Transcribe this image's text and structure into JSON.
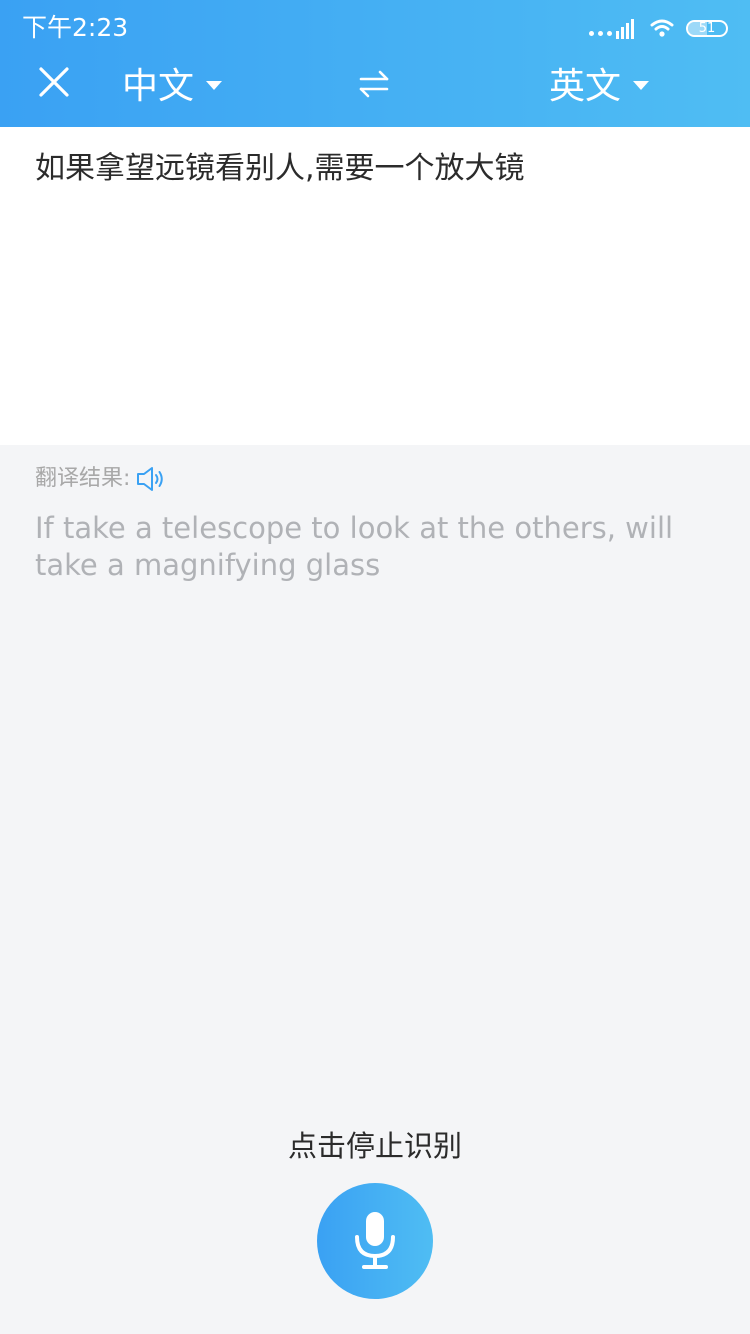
{
  "status_bar": {
    "time": "下午2:23",
    "battery": "51",
    "battery_level_percent": 51
  },
  "header": {
    "close_icon": "close-icon",
    "source_language": "中文",
    "target_language": "英文",
    "swap_icon": "swap-arrows-icon",
    "accent_color": "#3aa1f3"
  },
  "source": {
    "text": "如果拿望远镜看别人,需要一个放大镜"
  },
  "result": {
    "label": "翻译结果:",
    "speaker_icon": "speaker-icon",
    "text": "If take a telescope to look at the others, will take a magnifying glass"
  },
  "footer": {
    "hint": "点击停止识别",
    "mic_icon": "microphone-icon"
  }
}
